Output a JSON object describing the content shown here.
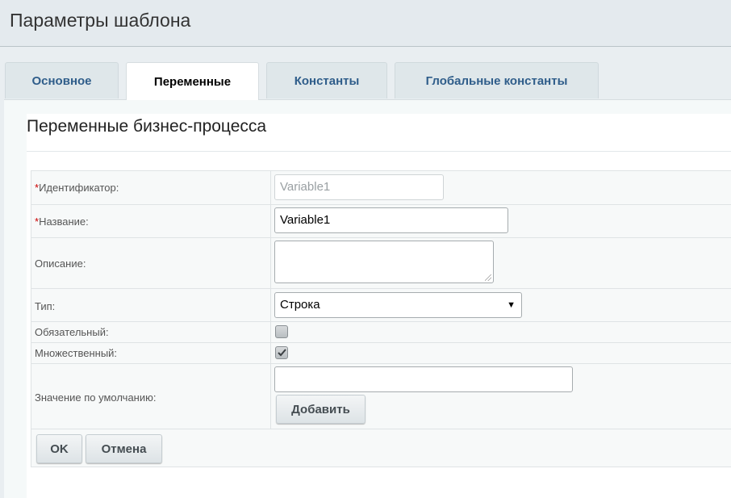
{
  "window": {
    "title": "Параметры шаблона"
  },
  "tabs": [
    {
      "label": "Основное",
      "active": false
    },
    {
      "label": "Переменные",
      "active": true
    },
    {
      "label": "Константы",
      "active": false
    },
    {
      "label": "Глобальные константы",
      "active": false
    }
  ],
  "section": {
    "title": "Переменные бизнес-процесса"
  },
  "form": {
    "required_mark": "*",
    "identifier": {
      "label": "Идентификатор:",
      "value": "Variable1",
      "disabled": true
    },
    "name": {
      "label": "Название:",
      "value": "Variable1"
    },
    "description": {
      "label": "Описание:",
      "value": ""
    },
    "type": {
      "label": "Тип:",
      "selected": "Строка",
      "arrow": "▼"
    },
    "required": {
      "label": "Обязательный:",
      "checked": false
    },
    "multiple": {
      "label": "Множественный:",
      "checked": true
    },
    "default_value": {
      "label": "Значение по умолчанию:",
      "value": "",
      "add_label": "Добавить"
    }
  },
  "buttons": {
    "ok": "OK",
    "cancel": "Отмена"
  },
  "colors": {
    "tab_text": "#2f5d8a",
    "required_mark": "#cc0000",
    "background": "#e9eef1"
  }
}
